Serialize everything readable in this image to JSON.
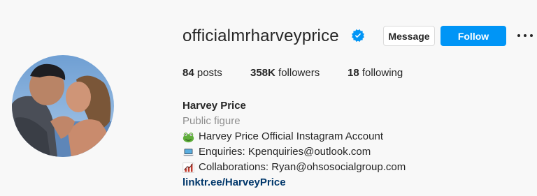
{
  "profile": {
    "username": "officialmrharveyprice",
    "verified": true,
    "verified_icon": "verified-badge-icon",
    "accent": "#0095f6"
  },
  "actions": {
    "message_label": "Message",
    "follow_label": "Follow",
    "more_icon": "more-options-icon"
  },
  "stats": {
    "posts_count": "84",
    "posts_label": " posts",
    "followers_count": "358K",
    "followers_label": " followers",
    "following_count": "18",
    "following_label": " following"
  },
  "bio": {
    "name": "Harvey Price",
    "category": "Public figure",
    "lines": [
      {
        "icon": "frog-emoji-icon",
        "text": "Harvey Price Official Instagram Account"
      },
      {
        "icon": "laptop-emoji-icon",
        "text": "Enquiries: Kpenquiries@outlook.com"
      },
      {
        "icon": "chart-emoji-icon",
        "text": "Collaborations: Ryan@ohsosocialgroup.com"
      }
    ],
    "link": "linktr.ee/HarveyPrice"
  }
}
